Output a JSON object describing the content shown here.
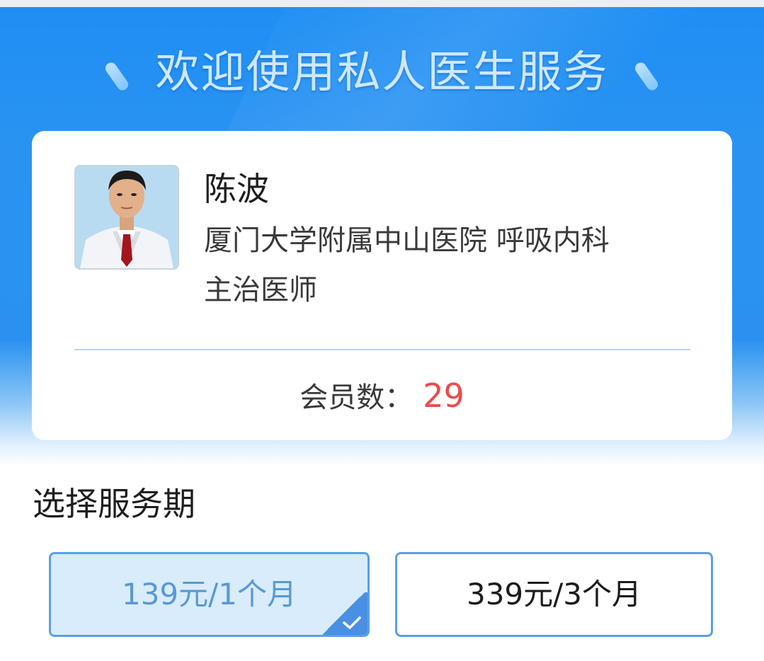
{
  "header": {
    "title": "欢迎使用私人医生服务"
  },
  "doctor": {
    "name": "陈波",
    "hospital": "厦门大学附属中山医院 呼吸内科",
    "title": "主治医师",
    "avatar_icon": "doctor-avatar"
  },
  "members": {
    "label": "会员数：",
    "count": "29"
  },
  "service_period": {
    "title": "选择服务期",
    "options": [
      {
        "label": "139元/1个月",
        "selected": true
      },
      {
        "label": "339元/3个月",
        "selected": false
      }
    ]
  },
  "colors": {
    "primary_blue": "#2a91f0",
    "selected_bg": "#d8ecfb",
    "accent_red": "#ec4a4a",
    "border_blue": "#5aa0e6"
  }
}
